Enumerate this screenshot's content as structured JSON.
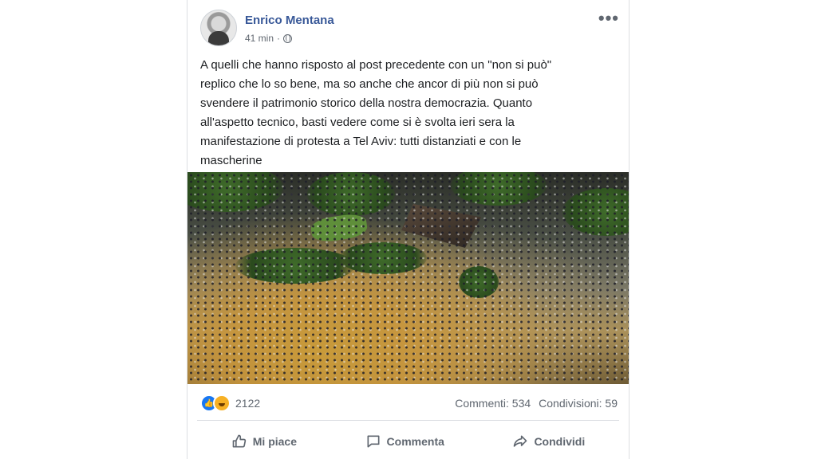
{
  "post": {
    "author": "Enrico Mentana",
    "time": "41 min",
    "separator": "·",
    "more_glyph": "•••",
    "text": "A quelli che hanno risposto al post precedente con un \"non si può\"\nreplico che lo so bene, ma so anche che ancor di più non si può\nsvendere il patrimonio storico della nostra democrazia. Quanto\nall'aspetto tecnico, basti vedere come si è svolta ieri sera la\nmanifestazione di protesta a Tel Aviv: tutti distanziati e con le\nmascherine"
  },
  "reactions": {
    "count": "2122",
    "icons": [
      "like-icon",
      "haha-icon"
    ],
    "comments": "Commenti: 534",
    "shares": "Condivisioni: 59"
  },
  "actions": {
    "like": "Mi piace",
    "comment": "Commenta",
    "share": "Condividi"
  },
  "colors": {
    "author_link": "#385898",
    "secondary_text": "#606770",
    "like_blue": "#1877f2",
    "haha_yellow": "#f7b125"
  }
}
